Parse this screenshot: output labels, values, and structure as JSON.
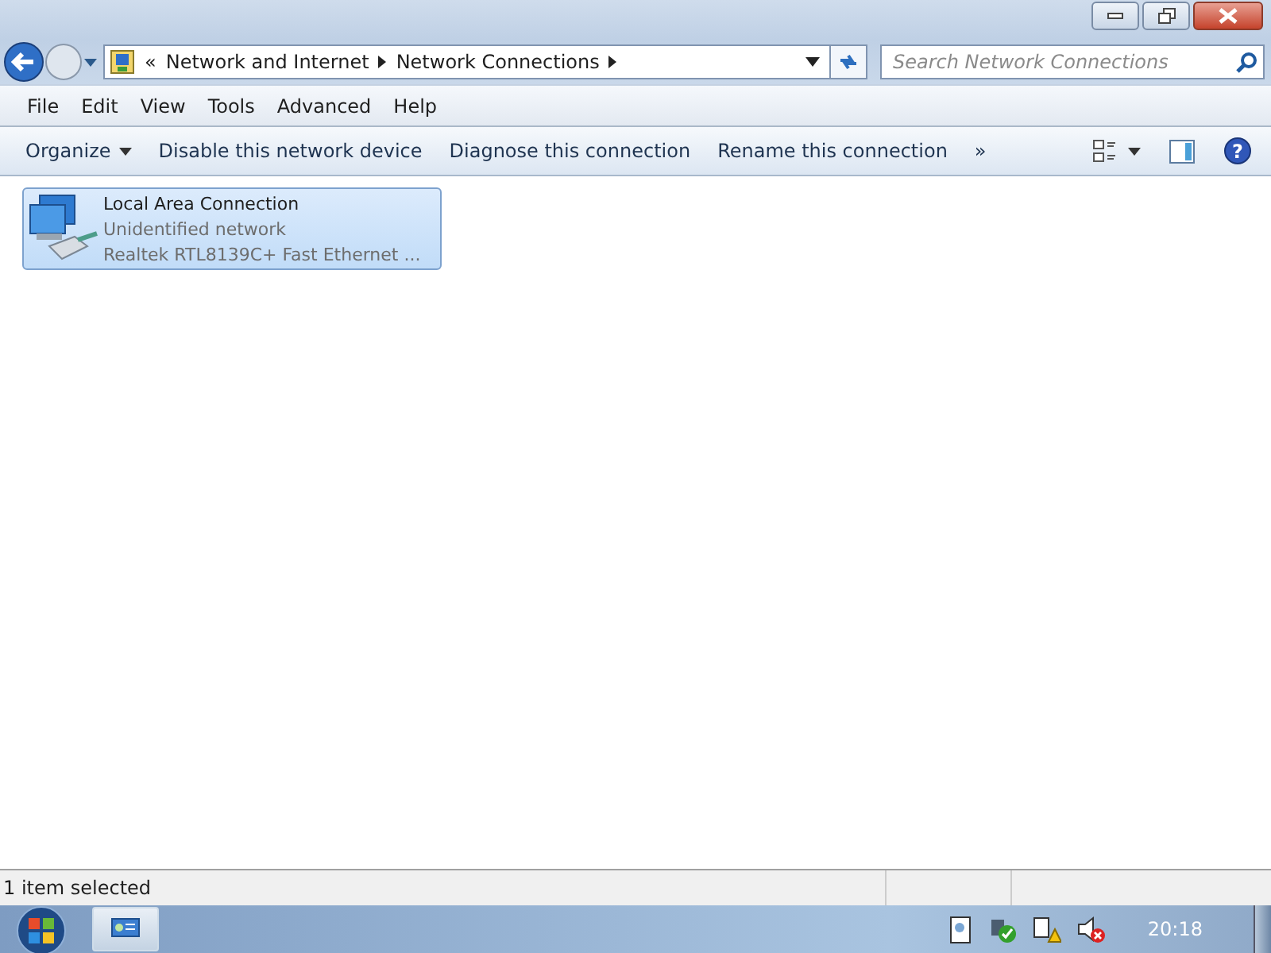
{
  "address_bar": {
    "overflow": "«",
    "crumbs": [
      "Network and Internet",
      "Network Connections"
    ]
  },
  "search": {
    "placeholder": "Search Network Connections"
  },
  "menu": [
    "File",
    "Edit",
    "View",
    "Tools",
    "Advanced",
    "Help"
  ],
  "commands": [
    {
      "label": "Organize",
      "dropdown": true
    },
    {
      "label": "Disable this network device",
      "dropdown": false
    },
    {
      "label": "Diagnose this connection",
      "dropdown": false
    },
    {
      "label": "Rename this connection",
      "dropdown": false
    }
  ],
  "more_commands": "»",
  "help": "?",
  "connections": [
    {
      "name": "Local Area Connection",
      "status": "Unidentified network",
      "device": "Realtek RTL8139C+ Fast Ethernet ...",
      "selected": true
    }
  ],
  "status_bar": {
    "text": "1 item selected"
  },
  "taskbar": {
    "clock": "20:18"
  }
}
